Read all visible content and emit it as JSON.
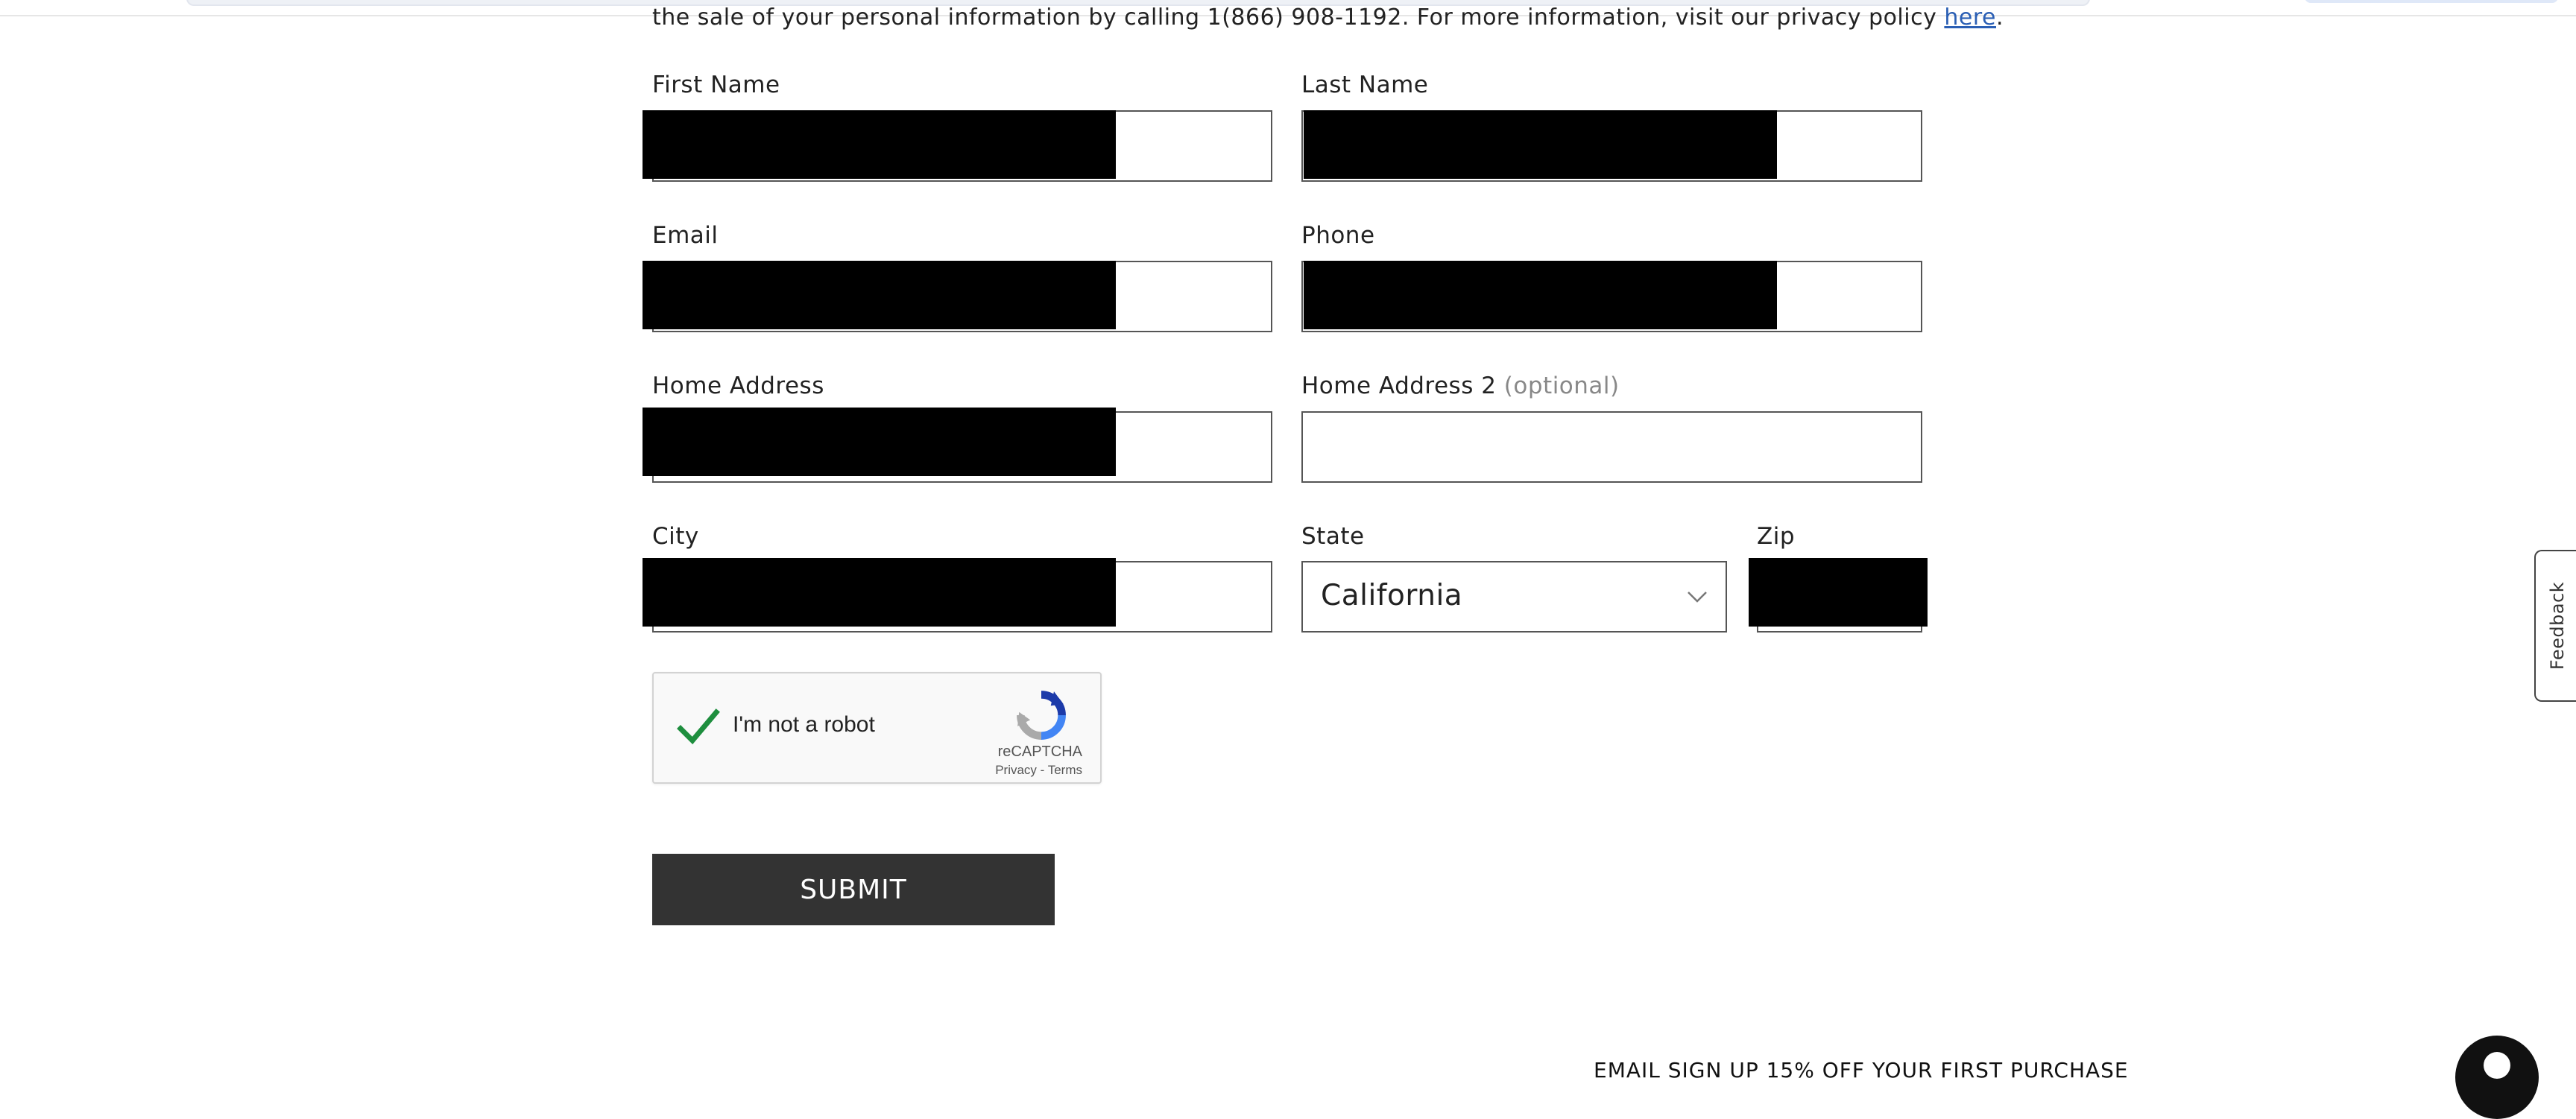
{
  "notice": {
    "text": "the sale of your personal information by calling 1(866) 908-1192. For more information, visit our privacy policy ",
    "link_text": "here",
    "tail": "."
  },
  "form": {
    "first_name": {
      "label": "First Name",
      "value": ""
    },
    "last_name": {
      "label": "Last Name",
      "value": ""
    },
    "email": {
      "label": "Email",
      "value": ""
    },
    "phone": {
      "label": "Phone",
      "value": ""
    },
    "home_address": {
      "label": "Home Address",
      "value": ""
    },
    "home_address_2": {
      "label": "Home Address 2",
      "optional": "(optional)",
      "value": ""
    },
    "city": {
      "label": "City",
      "value": ""
    },
    "state": {
      "label": "State",
      "value": "California"
    },
    "zip": {
      "label": "Zip",
      "value": ""
    }
  },
  "recaptcha": {
    "label": "I'm not a robot",
    "brand": "reCAPTCHA",
    "links": "Privacy - Terms",
    "checked": true
  },
  "submit_label": "SUBMIT",
  "feedback_label": "Feedback",
  "footer_text": "EMAIL SIGN UP 15% OFF YOUR FIRST PURCHASE",
  "colors": {
    "link": "#2b5fb4",
    "button": "#333333",
    "check": "#1e8e3e"
  }
}
